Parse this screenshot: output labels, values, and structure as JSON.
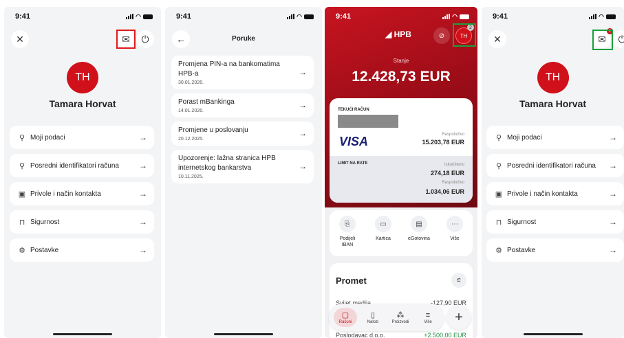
{
  "status": {
    "time": "9:41"
  },
  "profile": {
    "initials": "TH",
    "name": "Tamara Horvat",
    "items": [
      {
        "icon": "person-icon",
        "label": "Moji podaci"
      },
      {
        "icon": "id-icon",
        "label": "Posredni identifikatori računa"
      },
      {
        "icon": "consent-icon",
        "label": "Privole i način kontakta"
      },
      {
        "icon": "lock-icon",
        "label": "Sigurnost"
      },
      {
        "icon": "gear-icon",
        "label": "Postavke"
      }
    ]
  },
  "messages": {
    "title": "Poruke",
    "items": [
      {
        "title": "Promjena PIN-a na bankomatima HPB-a",
        "date": "30.01.2026."
      },
      {
        "title": "Porast mBankinga",
        "date": "14.01.2026."
      },
      {
        "title": "Promjene u poslovanju",
        "date": "20.12.2025."
      },
      {
        "title": "Upozorenje: lažna stranica HPB internetskog bankarstva",
        "date": "10.11.2025."
      }
    ]
  },
  "home": {
    "brand": "HPB",
    "avatar_initials": "TH",
    "notif_count": "2",
    "balance_label": "Stanje",
    "balance_value": "12.428,73 EUR",
    "account_label": "TEKUĆI RAČUN",
    "card_brand": "VISA",
    "available_label": "Raspoloživo",
    "available_value": "15.203,78 EUR",
    "limit_label": "LIMIT NA RATE",
    "used_label": "Iskorišteno",
    "used_value": "274,18 EUR",
    "limit_available_label": "Raspoloživo",
    "limit_available_value": "1.034,06 EUR",
    "actions": [
      {
        "icon": "share-icon",
        "label": "Podijeli IBAN"
      },
      {
        "icon": "card-icon",
        "label": "Kartica"
      },
      {
        "icon": "cash-icon",
        "label": "eGotovina"
      },
      {
        "icon": "more-icon",
        "label": "Više"
      }
    ],
    "promet_title": "Promet",
    "transactions": [
      {
        "name": "Svijet medija",
        "amount": "-127,90 EUR"
      },
      {
        "name": "Poslodavac d.o.o.",
        "amount": "+2.500,00 EUR"
      }
    ],
    "tabs": [
      {
        "icon": "accounts-icon",
        "label": "Računi"
      },
      {
        "icon": "orders-icon",
        "label": "Nalozi"
      },
      {
        "icon": "products-icon",
        "label": "Proizvodi"
      },
      {
        "icon": "menu-icon",
        "label": "Više"
      }
    ]
  },
  "profile2": {
    "notif_count": "2"
  }
}
